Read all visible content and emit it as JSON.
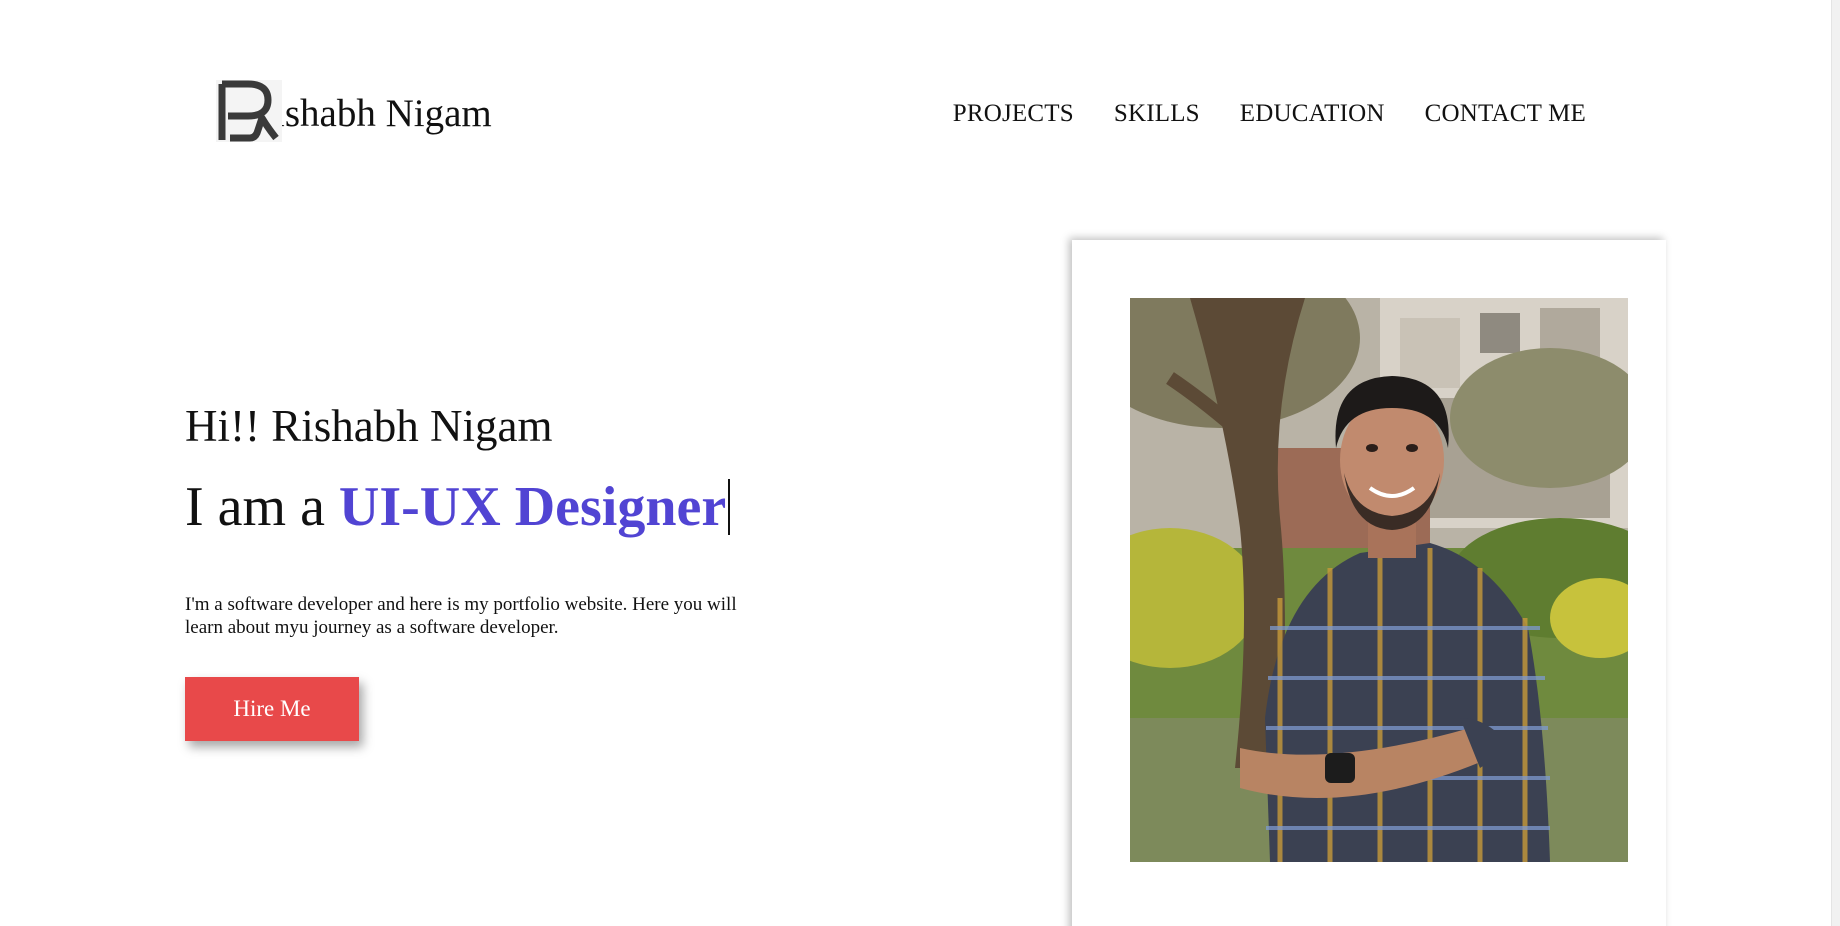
{
  "header": {
    "logo_letter": "R",
    "brand_name": "ishabh Nigam",
    "nav": [
      {
        "label": "PROJECTS"
      },
      {
        "label": "SKILLS"
      },
      {
        "label": "EDUCATION"
      },
      {
        "label": "CONTACT ME"
      }
    ]
  },
  "hero": {
    "greeting": "Hi!! Rishabh Nigam",
    "role_prefix": "I am a ",
    "role": "UI-UX Designer",
    "intro": "I'm a software developer and here is my portfolio website. Here you will learn about myu journey as a software developer.",
    "cta_label": "Hire Me"
  },
  "colors": {
    "accent": "#5144d3",
    "cta": "#e8494a"
  },
  "photo": {
    "icon": "portrait-photo"
  }
}
